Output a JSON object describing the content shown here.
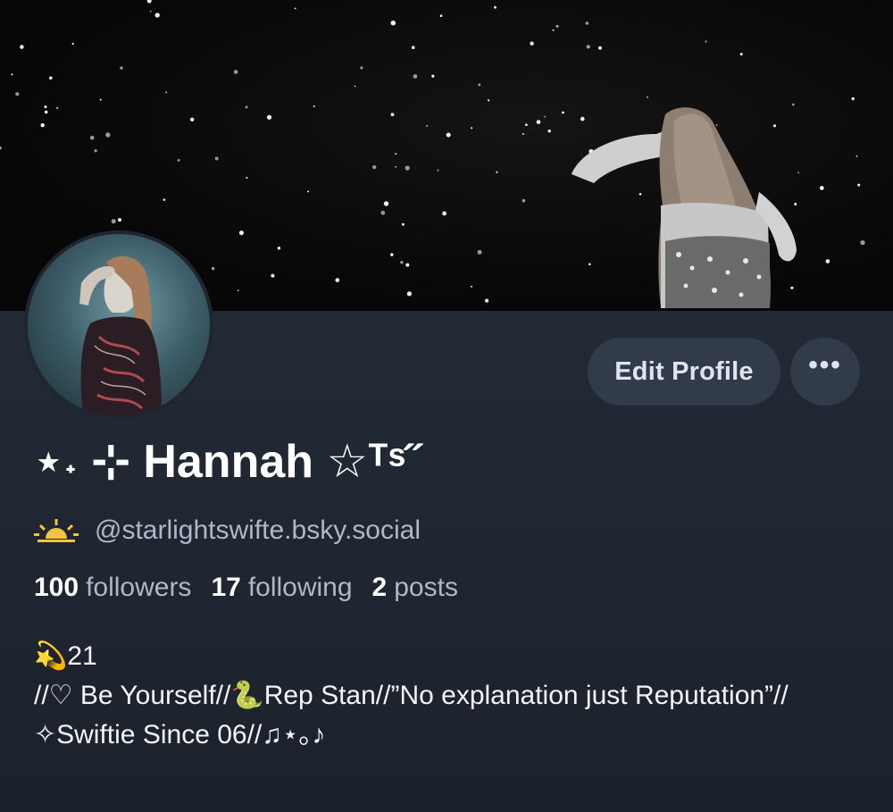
{
  "banner": {
    "alt": "concert night sky banner"
  },
  "avatar": {
    "alt": "profile avatar"
  },
  "actions": {
    "edit_profile_label": "Edit Profile",
    "more_label": "•••"
  },
  "profile": {
    "display_name": "⋆˖ ⊹ Hannah ☆ᵀˢ˝",
    "handle_prefix_icon": "sunrise-icon",
    "handle": "@starlightswifte.bsky.social",
    "stats": [
      {
        "count": "100",
        "label": "followers"
      },
      {
        "count": "17",
        "label": "following"
      },
      {
        "count": "2",
        "label": "posts"
      }
    ],
    "bio": "💫21\n//♡ Be Yourself//🐍Rep Stan//”No explanation just Reputation”// ✧Swiftie Since 06//♫⋆｡♪"
  },
  "colors": {
    "background": "#1e2530",
    "button": "#313b49",
    "text_primary": "#ffffff",
    "text_secondary": "#aeb8c6",
    "sun_icon": "#f5c242"
  }
}
